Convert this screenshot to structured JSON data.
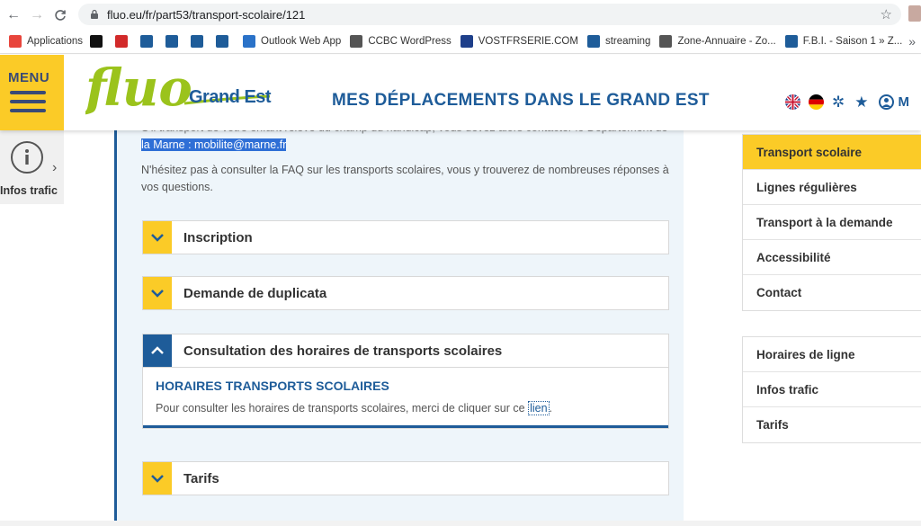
{
  "browser": {
    "url": "fluo.eu/fr/part53/transport-scolaire/121",
    "bookmarks": [
      {
        "label": "Applications",
        "icon": "apps-grid-icon",
        "color": "#e8453c"
      },
      {
        "label": "",
        "icon": "d-logo-icon",
        "color": "#111111"
      },
      {
        "label": "",
        "icon": "gp-logo-icon",
        "color": "#d22a2a"
      },
      {
        "label": "",
        "icon": "train-icon",
        "color": "#1e5c99"
      },
      {
        "label": "",
        "icon": "s-logo-icon",
        "color": "#1e5c99"
      },
      {
        "label": "",
        "icon": "fish-icon",
        "color": "#1e5c99"
      },
      {
        "label": "",
        "icon": "bird-icon",
        "color": "#1e5c99"
      },
      {
        "label": "Outlook Web App",
        "icon": "outlook-icon",
        "color": "#2a72c8"
      },
      {
        "label": "CCBC WordPress",
        "icon": "globe-icon",
        "color": "#555555"
      },
      {
        "label": "VOSTFRSERIE.COM",
        "icon": "vs-logo-icon",
        "color": "#1e3f8a"
      },
      {
        "label": "streaming",
        "icon": "train-icon",
        "color": "#1e5c99"
      },
      {
        "label": "Zone-Annuaire - Zo...",
        "icon": "globe-icon",
        "color": "#555555"
      },
      {
        "label": "F.B.I. - Saison 1 » Z...",
        "icon": "globe-icon",
        "color": "#1e5c99"
      }
    ],
    "more": "»"
  },
  "header": {
    "menu_label": "MENU",
    "logo_text": "fluo",
    "logo_sub": "Grand Est",
    "title": "MES DÉPLACEMENTS DANS LE GRAND EST",
    "user_initial": "M"
  },
  "left_widget": {
    "label": "Infos trafic"
  },
  "content": {
    "intro_partial": "S'il transport de votre enfant relève du champ du handicap, vous devez alors contacter le Département de",
    "intro_highlight": "la Marne : mobilite@marne.fr",
    "faq_text": "N'hésitez pas à consulter la FAQ sur les transports scolaires, vous y trouverez de nombreuses réponses à vos questions.",
    "accordion": [
      {
        "title": "Inscription"
      },
      {
        "title": "Demande de duplicata"
      },
      {
        "title": "Consultation des horaires de transports scolaires",
        "subtitle": "HORAIRES TRANSPORTS SCOLAIRES",
        "text_before": "Pour consulter les horaires de transports scolaires, merci de cliquer sur ce ",
        "link": "lien",
        "text_after": "."
      },
      {
        "title": "Tarifs"
      }
    ]
  },
  "sidebar": {
    "primary": [
      "Transport scolaire",
      "Lignes régulières",
      "Transport à la demande",
      "Accessibilité",
      "Contact"
    ],
    "secondary": [
      "Horaires de ligne",
      "Infos trafic",
      "Tarifs"
    ]
  },
  "colors": {
    "accent_yellow": "#fbcb27",
    "brand_blue": "#1e5c99",
    "logo_green": "#9bc31c"
  }
}
